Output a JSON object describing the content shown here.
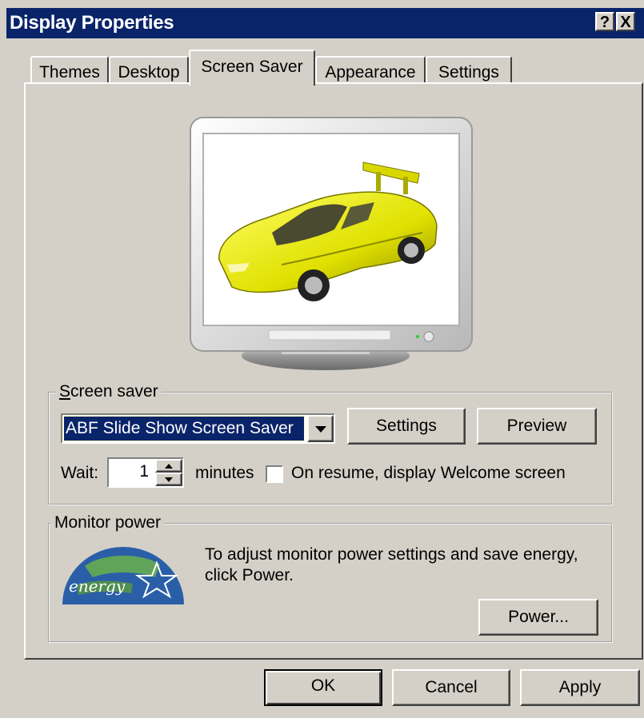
{
  "window": {
    "title": "Display Properties",
    "help_button": "?",
    "close_button": "X"
  },
  "tabs": [
    {
      "label": "Themes"
    },
    {
      "label": "Desktop"
    },
    {
      "label": "Screen Saver",
      "selected": true
    },
    {
      "label": "Appearance"
    },
    {
      "label": "Settings"
    }
  ],
  "screen_saver_group": {
    "label": "Screen saver",
    "selected_saver": "ABF Slide Show Screen Saver",
    "settings_button": "Settings",
    "preview_button": "Preview",
    "wait_label": "Wait:",
    "wait_value": "1",
    "minutes_label": "minutes",
    "welcome_checkbox_label": "On resume, display Welcome screen",
    "welcome_checked": false
  },
  "monitor_power_group": {
    "label": "Monitor power",
    "description_line1": "To adjust monitor power settings and save energy,",
    "description_line2": "click Power.",
    "power_button": "Power...",
    "logo_text": "energy"
  },
  "dialog_buttons": {
    "ok": "OK",
    "cancel": "Cancel",
    "apply": "Apply"
  },
  "colors": {
    "title_bar": "#0a246a",
    "face": "#d4d0c8",
    "selection": "#0a246a",
    "car": "#e6e600"
  }
}
